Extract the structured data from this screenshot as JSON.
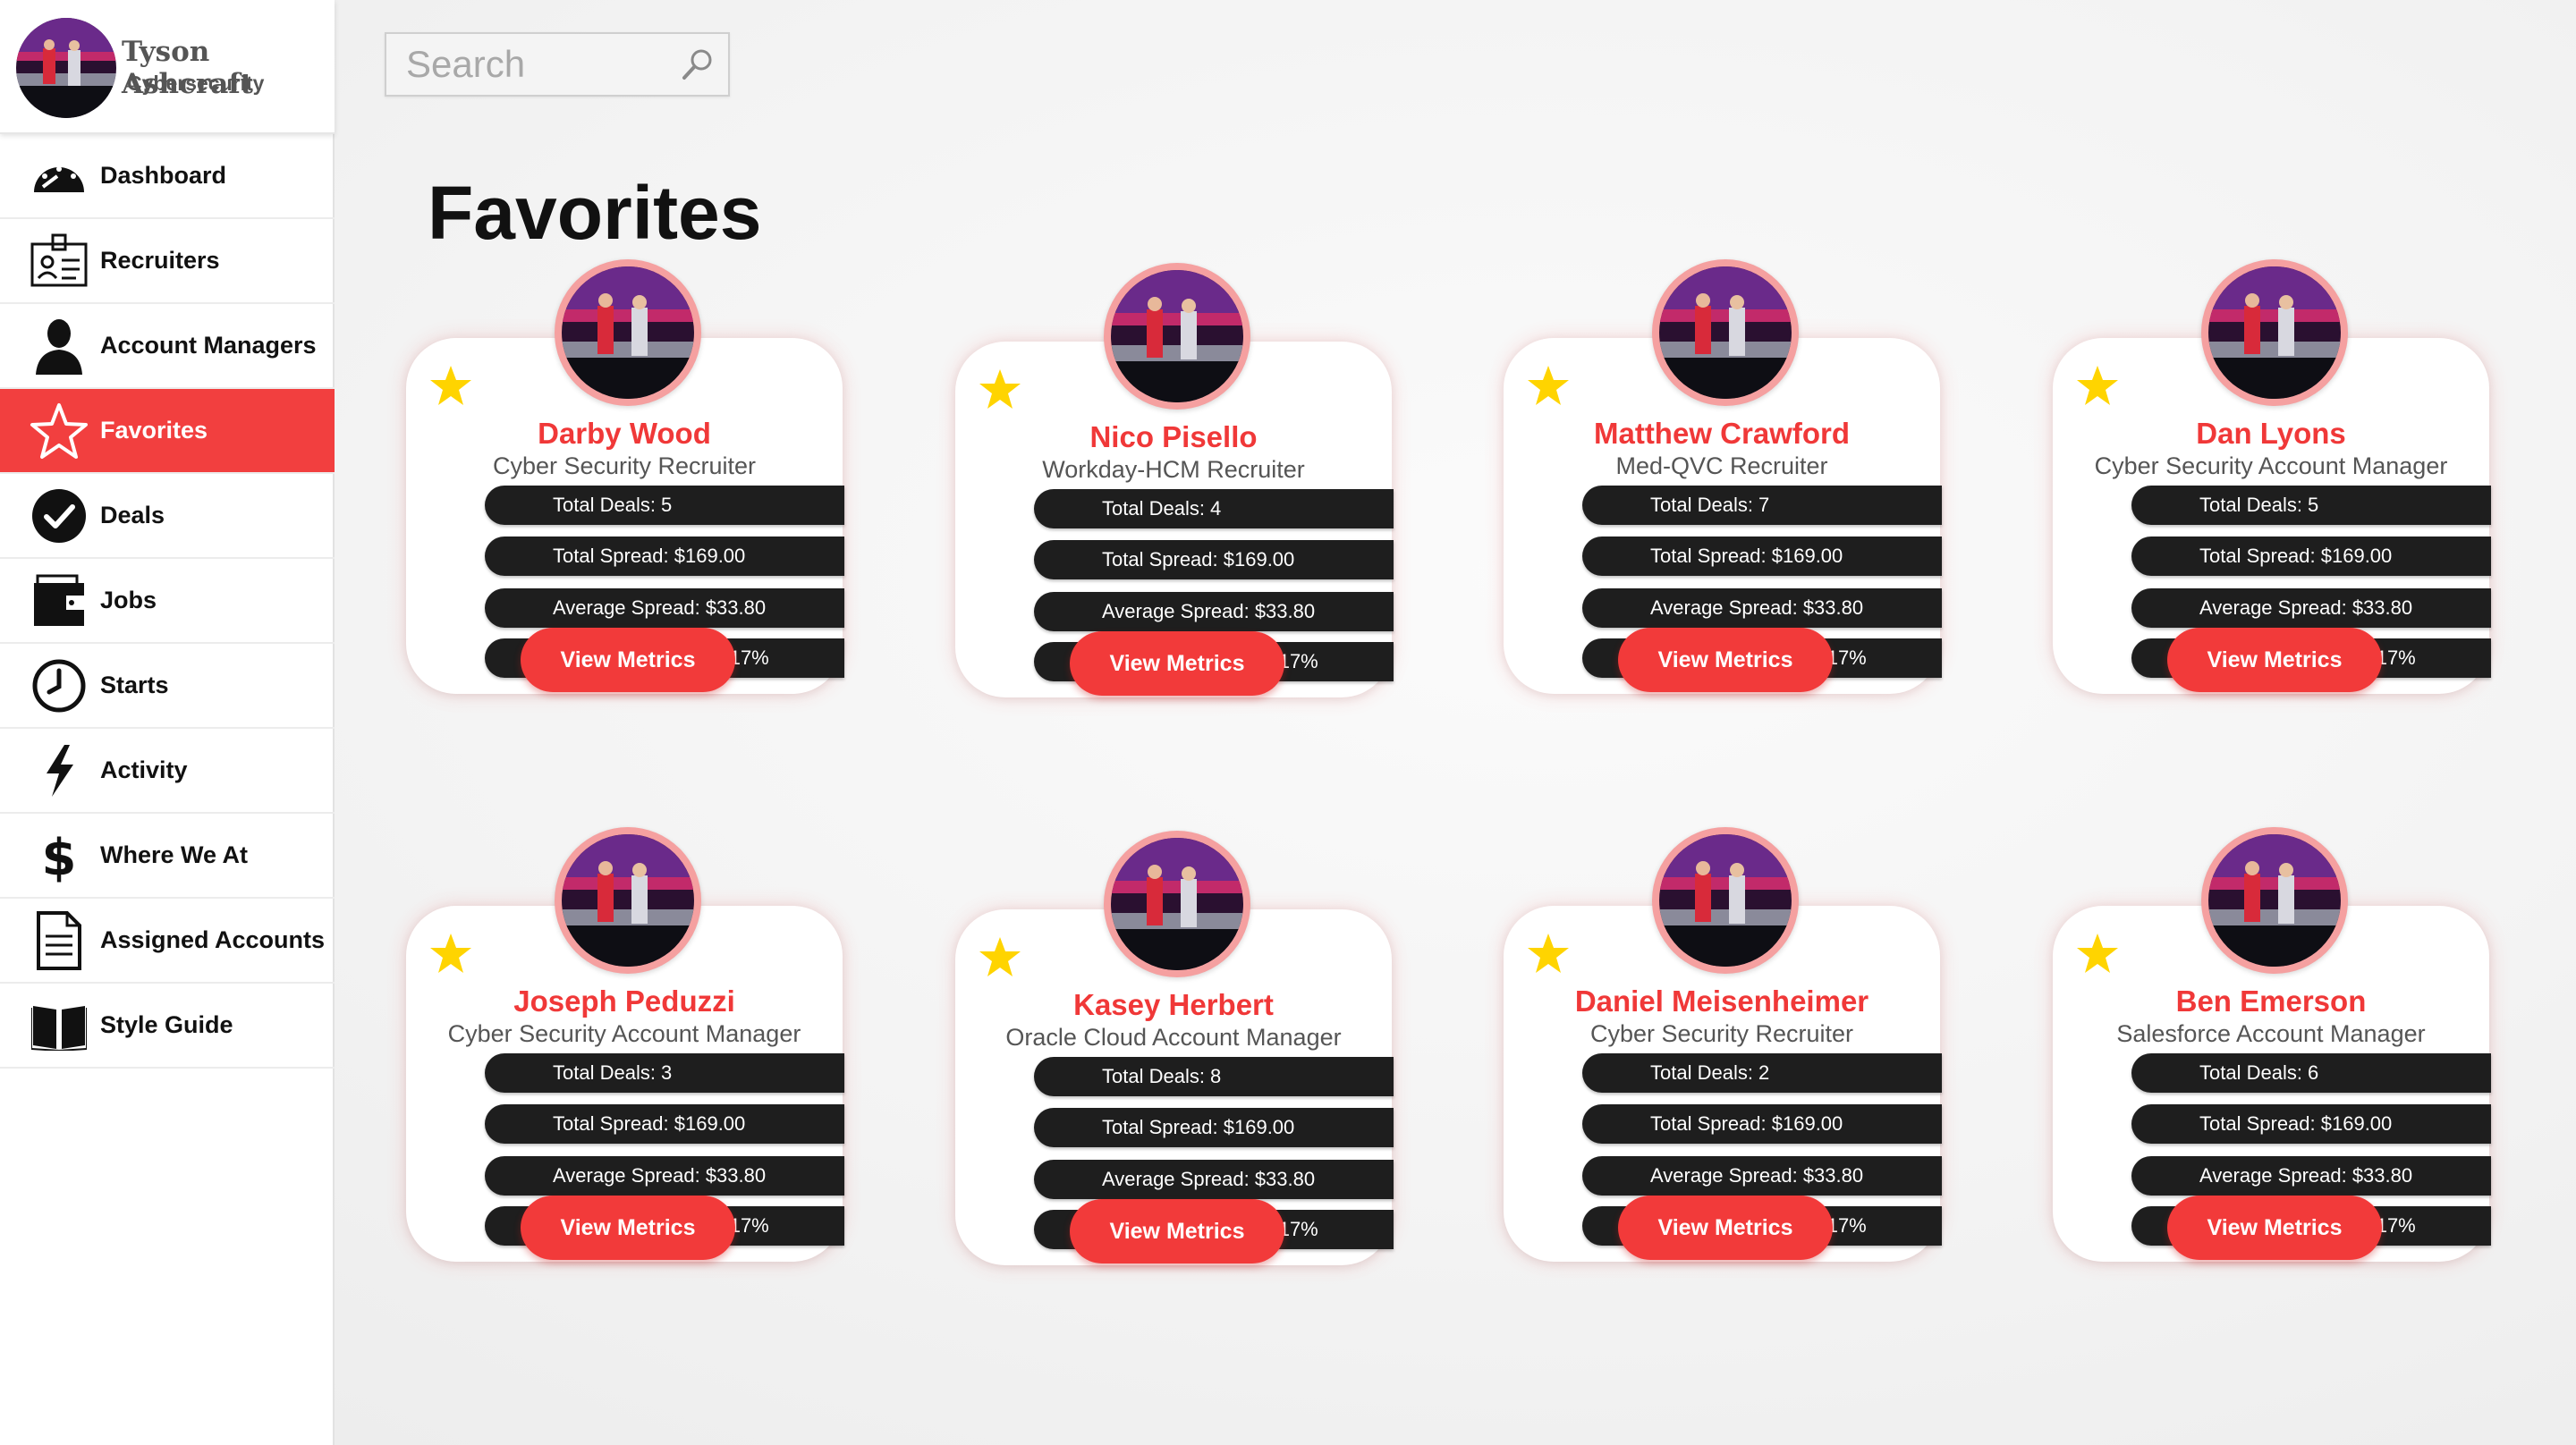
{
  "profile": {
    "name": "Tyson Ashcraft",
    "department": "Cybersecurity"
  },
  "nav": [
    {
      "label": "Dashboard",
      "icon": "speedometer-icon",
      "active": false
    },
    {
      "label": "Recruiters",
      "icon": "id-badge-icon",
      "active": false
    },
    {
      "label": "Account Managers",
      "icon": "person-silhouette-icon",
      "active": false
    },
    {
      "label": "Favorites",
      "icon": "star-outline-icon",
      "active": true
    },
    {
      "label": "Deals",
      "icon": "check-circle-icon",
      "active": false
    },
    {
      "label": "Jobs",
      "icon": "wallet-icon",
      "active": false
    },
    {
      "label": "Starts",
      "icon": "clock-icon",
      "active": false
    },
    {
      "label": "Activity",
      "icon": "lightning-icon",
      "active": false
    },
    {
      "label": "Where We At",
      "icon": "dollar-icon",
      "active": false
    },
    {
      "label": "Assigned Accounts",
      "icon": "document-icon",
      "active": false
    },
    {
      "label": "Style Guide",
      "icon": "book-icon",
      "active": false
    }
  ],
  "search": {
    "placeholder": "Search"
  },
  "page_title": "Favorites",
  "colors": {
    "accent": "#f23f3f",
    "star": "#ffd400",
    "stat_bg": "#1e1e1e"
  },
  "cards": [
    {
      "name": "Darby Wood",
      "role": "Cyber Security Recruiter",
      "total_deals": "Total Deals: 5",
      "total_spread": "Total Spread: $169.00",
      "average_spread": "Average Spread: $33.80",
      "average_margin": "Average Margin: 27.17%",
      "button": "View Metrics"
    },
    {
      "name": "Nico Pisello",
      "role": "Workday-HCM Recruiter",
      "total_deals": "Total Deals: 4",
      "total_spread": "Total Spread: $169.00",
      "average_spread": "Average Spread: $33.80",
      "average_margin": "Average Margin: 27.17%",
      "button": "View Metrics"
    },
    {
      "name": "Matthew Crawford",
      "role": "Med-QVC Recruiter",
      "total_deals": "Total Deals: 7",
      "total_spread": "Total Spread: $169.00",
      "average_spread": "Average Spread: $33.80",
      "average_margin": "Average Margin: 27.17%",
      "button": "View Metrics"
    },
    {
      "name": "Dan Lyons",
      "role": "Cyber Security Account Manager",
      "total_deals": "Total Deals: 5",
      "total_spread": "Total Spread: $169.00",
      "average_spread": "Average Spread: $33.80",
      "average_margin": "Average Margin: 27.17%",
      "button": "View Metrics"
    },
    {
      "name": "Joseph Peduzzi",
      "role": "Cyber Security Account Manager",
      "total_deals": "Total Deals: 3",
      "total_spread": "Total Spread: $169.00",
      "average_spread": "Average Spread: $33.80",
      "average_margin": "Average Margin: 27.17%",
      "button": "View Metrics"
    },
    {
      "name": "Kasey Herbert",
      "role": "Oracle Cloud Account Manager",
      "total_deals": "Total Deals: 8",
      "total_spread": "Total Spread: $169.00",
      "average_spread": "Average Spread: $33.80",
      "average_margin": "Average Margin: 27.17%",
      "button": "View Metrics"
    },
    {
      "name": "Daniel Meisenheimer",
      "role": "Cyber Security Recruiter",
      "total_deals": "Total Deals: 2",
      "total_spread": "Total Spread: $169.00",
      "average_spread": "Average Spread: $33.80",
      "average_margin": "Average Margin: 27.17%",
      "button": "View Metrics"
    },
    {
      "name": "Ben Emerson",
      "role": "Salesforce Account Manager",
      "total_deals": "Total Deals: 6",
      "total_spread": "Total Spread: $169.00",
      "average_spread": "Average Spread: $33.80",
      "average_margin": "Average Margin: 27.17%",
      "button": "View Metrics"
    }
  ]
}
